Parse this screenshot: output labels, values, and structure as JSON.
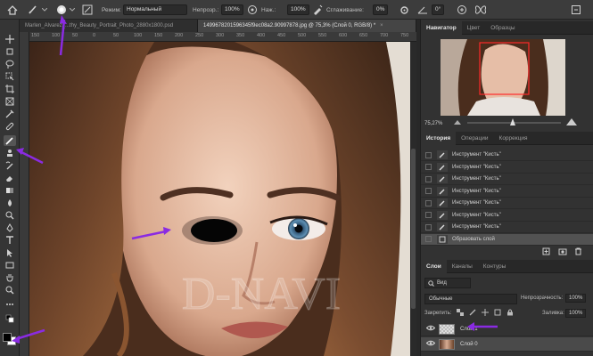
{
  "options": {
    "mode_label": "Режим:",
    "mode_value": "Нормальный",
    "opacity_label": "Непрозр.:",
    "opacity_value": "100%",
    "pressure_label": "Наж.:",
    "pressure_value": "100%",
    "smoothing_label": "Сглаживание:",
    "smoothing_value": "0%",
    "angle_value": "0°"
  },
  "tabs": [
    {
      "label": "Marlen_Alvarez_...thy_Beauty_Portrait_Photo_2880x1800.psd",
      "active": false
    },
    {
      "label": "1499678201596345f9ec08a2.90997878.jpg @ 75,3% (Слой 0, RGB/8) *",
      "active": true
    }
  ],
  "ruler": [
    "150",
    "100",
    "50",
    "0",
    "50",
    "100",
    "150",
    "200",
    "250",
    "300",
    "350",
    "400",
    "450",
    "500",
    "550",
    "600",
    "650",
    "700",
    "750"
  ],
  "watermark": "D-NAVI",
  "navigator": {
    "tabs": [
      "Навигатор",
      "Цвет",
      "Образцы"
    ],
    "zoom": "75,27%"
  },
  "history": {
    "tabs": [
      "История",
      "Операции",
      "Коррекция"
    ],
    "items": [
      "Инструмент \"Кисть\"",
      "Инструмент \"Кисть\"",
      "Инструмент \"Кисть\"",
      "Инструмент \"Кисть\"",
      "Инструмент \"Кисть\"",
      "Инструмент \"Кисть\"",
      "Инструмент \"Кисть\"",
      "Образовать слой"
    ]
  },
  "layers": {
    "tabs": [
      "Слои",
      "Каналы",
      "Контуры"
    ],
    "filter_label": "Вид",
    "blend_mode": "Обычные",
    "opacity_label": "Непрозрачность:",
    "opacity_value": "100%",
    "lock_label": "Закрепить:",
    "fill_label": "Заливка:",
    "fill_value": "100%",
    "items": [
      {
        "name": "Слой 1",
        "selected": false
      },
      {
        "name": "Слой 0",
        "selected": true
      }
    ]
  },
  "colors": {
    "annotation_arrow": "#8a2be2",
    "panel_bg": "#323232",
    "nav_frame": "#ff2a2a"
  }
}
